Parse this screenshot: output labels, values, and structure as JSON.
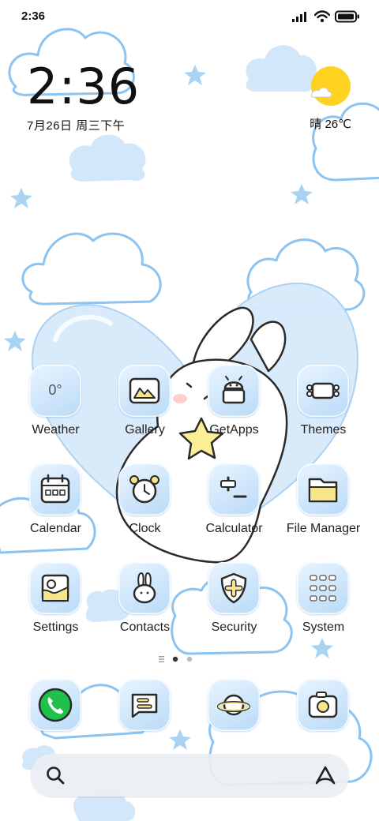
{
  "status_bar": {
    "time": "2:36",
    "icons": [
      "signal-icon",
      "wifi-icon",
      "battery-icon"
    ]
  },
  "clock_widget": {
    "time": "2:36",
    "date": "7月26日 周三下午"
  },
  "weather_widget": {
    "icon": "sun-cloud-icon",
    "text": "晴 26℃"
  },
  "apps": [
    {
      "label": "Weather",
      "icon": "weather-icon",
      "icon_text": "0°"
    },
    {
      "label": "Gallery",
      "icon": "gallery-icon"
    },
    {
      "label": "GetApps",
      "icon": "getapps-icon"
    },
    {
      "label": "Themes",
      "icon": "themes-icon"
    },
    {
      "label": "Calendar",
      "icon": "calendar-icon"
    },
    {
      "label": "Clock",
      "icon": "alarm-clock-icon"
    },
    {
      "label": "Calculator",
      "icon": "calculator-icon"
    },
    {
      "label": "File Manager",
      "icon": "folder-icon"
    },
    {
      "label": "Settings",
      "icon": "settings-icon"
    },
    {
      "label": "Contacts",
      "icon": "bunny-icon"
    },
    {
      "label": "Security",
      "icon": "shield-icon"
    },
    {
      "label": "System",
      "icon": "system-folder-icon"
    }
  ],
  "pager": {
    "pages": 2,
    "current": 1
  },
  "dock": [
    {
      "icon": "phone-icon"
    },
    {
      "icon": "messages-icon"
    },
    {
      "icon": "browser-planet-icon"
    },
    {
      "icon": "camera-icon"
    }
  ],
  "search_bar": {
    "left_icon": "search-icon",
    "right_icon": "assistant-icon"
  },
  "colors": {
    "sky": "#ffffff",
    "cloud_outline": "#8cc3f0",
    "cloud_fill": "#d2e8fa",
    "heart": "#cfe5f8",
    "sun": "#ffd21f",
    "icon_tile": "#cfe6fb",
    "phone_green": "#1fc04b"
  }
}
